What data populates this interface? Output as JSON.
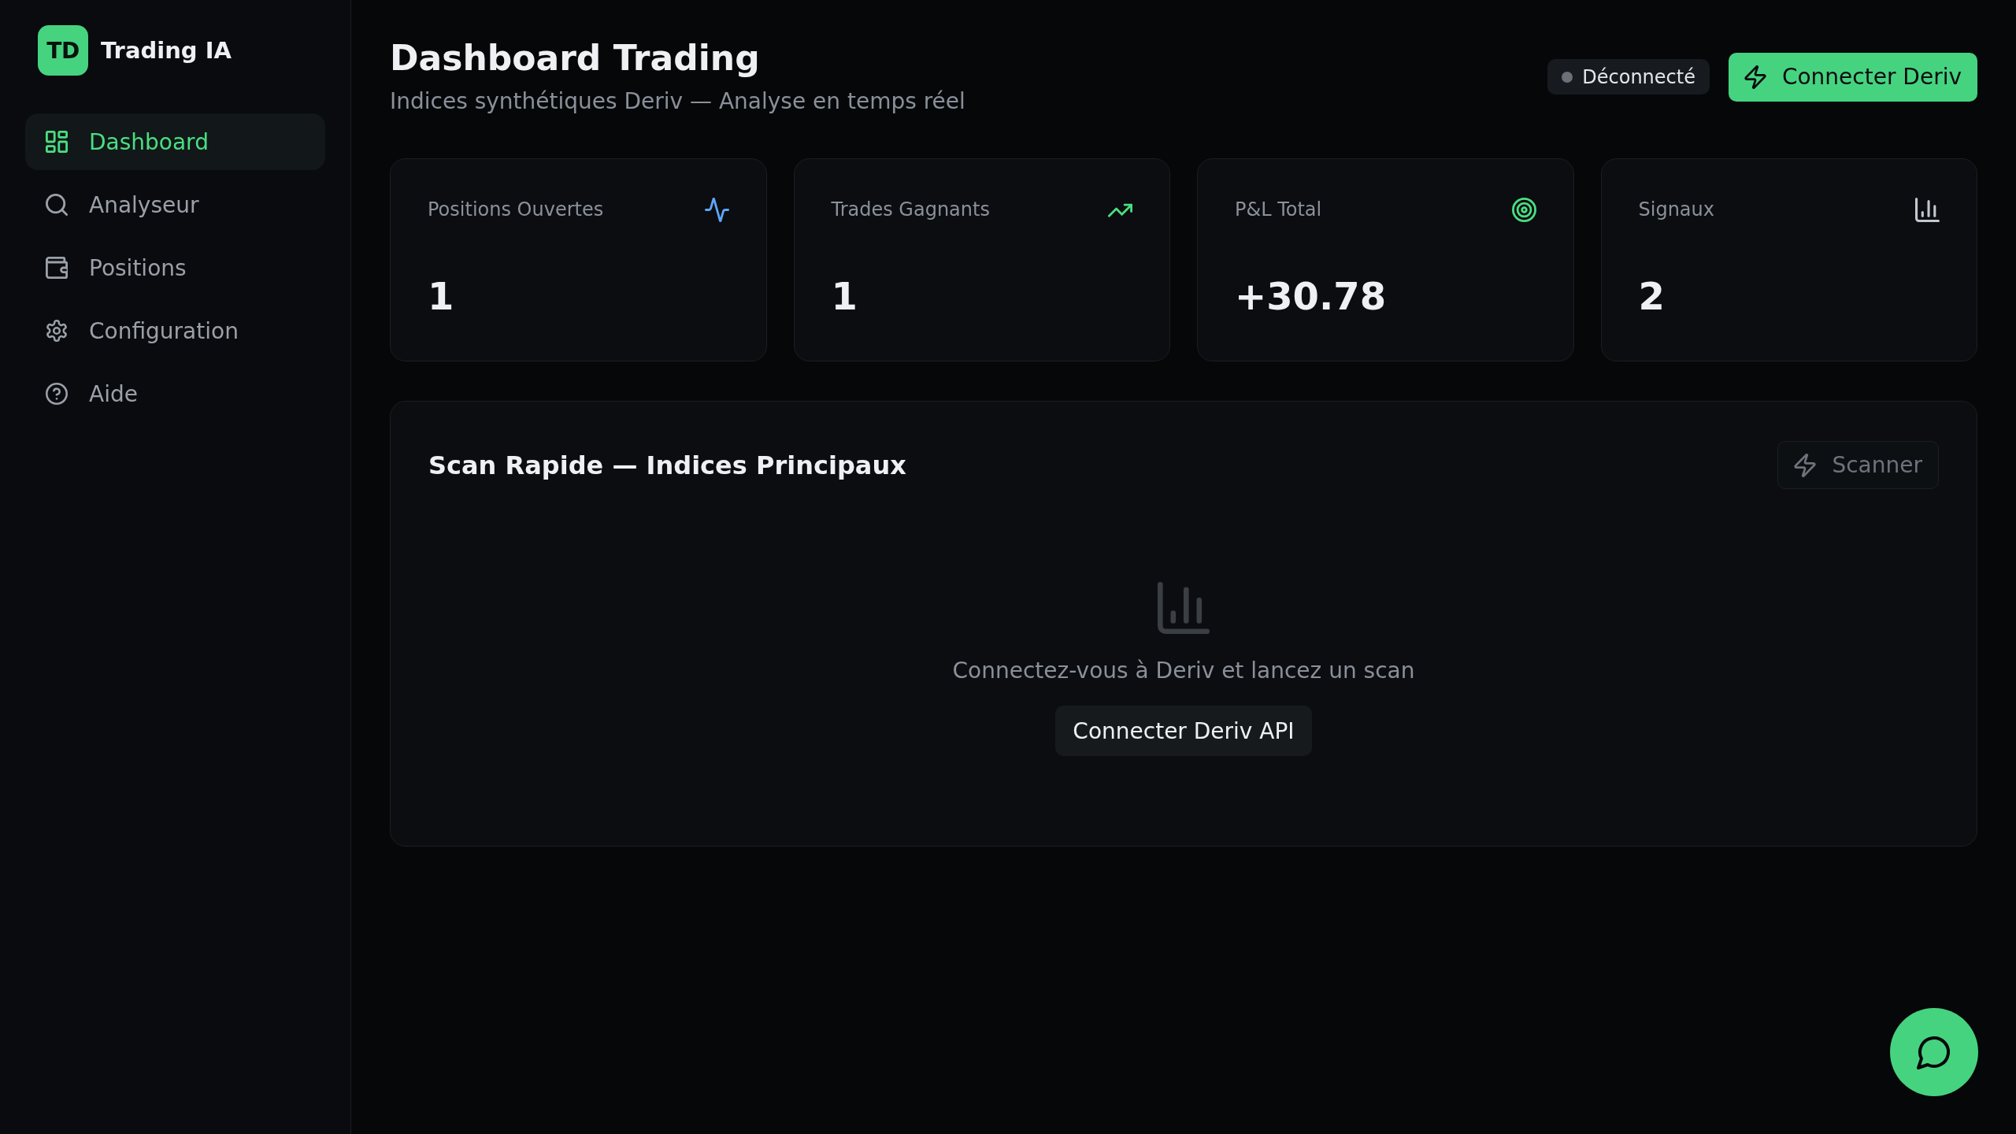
{
  "sidebar": {
    "logo": {
      "initials": "TD",
      "name": "Trading IA"
    },
    "items": [
      {
        "label": "Dashboard",
        "selected": true
      },
      {
        "label": "Analyseur",
        "selected": false
      },
      {
        "label": "Positions",
        "selected": false
      },
      {
        "label": "Configuration",
        "selected": false
      },
      {
        "label": "Aide",
        "selected": false
      }
    ]
  },
  "header": {
    "title": "Dashboard Trading",
    "subtitle": "Indices synthétiques Deriv — Analyse en temps réel",
    "status": {
      "label": "Déconnecté",
      "connected": false
    },
    "connect_button": "Connecter Deriv"
  },
  "stats": [
    {
      "label": "Positions Ouvertes",
      "value": "1",
      "color": "#60a5fa"
    },
    {
      "label": "Trades Gagnants",
      "value": "1",
      "color": "#4ade80"
    },
    {
      "label": "P&L Total",
      "value": "+30.78",
      "color": "#4ade80"
    },
    {
      "label": "Signaux",
      "value": "2",
      "color": "#c4c8cf"
    }
  ],
  "scan_panel": {
    "title": "Scan Rapide — Indices Principaux",
    "scan_button": {
      "label": "Scanner",
      "disabled": true
    },
    "empty_message": "Connectez-vous à Deriv et lancez un scan",
    "connect_api_button": "Connecter Deriv API"
  }
}
